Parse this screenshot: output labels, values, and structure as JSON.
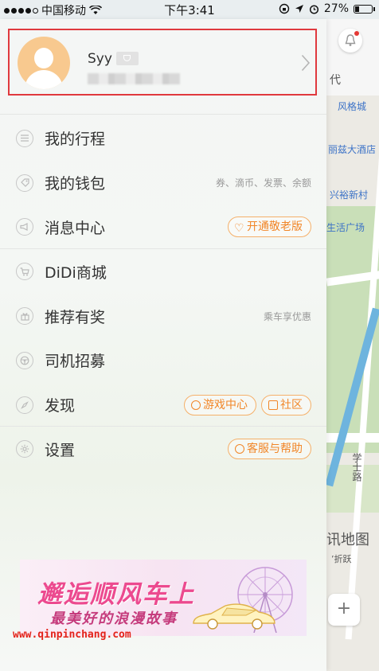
{
  "status_bar": {
    "carrier": "中国移动",
    "time": "下午3:41",
    "battery": "27%",
    "battery_level": 0.27
  },
  "profile": {
    "username": "Syy",
    "phone_masked": ""
  },
  "menu": {
    "items": [
      {
        "label": "我的行程",
        "icon": "list-icon"
      },
      {
        "label": "我的钱包",
        "icon": "wallet-tag-icon",
        "sub": "券、滴币、发票、余额"
      },
      {
        "label": "消息中心",
        "icon": "megaphone-icon",
        "pill": "开通敬老版"
      },
      {
        "label": "DiDi商城",
        "icon": "cart-icon"
      },
      {
        "label": "推荐有奖",
        "icon": "gift-icon",
        "sub": "乘车享优惠"
      },
      {
        "label": "司机招募",
        "icon": "steering-wheel-icon"
      },
      {
        "label": "发现",
        "icon": "compass-icon",
        "pills": [
          "游戏中心",
          "社区"
        ]
      },
      {
        "label": "设置",
        "icon": "gear-icon",
        "pill": "客服与帮助"
      }
    ]
  },
  "map": {
    "labels": [
      "代",
      "风格城",
      "丽兹大酒店",
      "兴裕新村",
      "生活广场",
      "学士路",
      "讯地图",
      "ʼ折跃"
    ]
  },
  "banner": {
    "title": "邂逅顺风车上",
    "subtitle": "最美好的浪漫故事"
  },
  "watermark": "www.qinpinchang.com",
  "colors": {
    "accent": "#f18628",
    "highlight_border": "#e0393e",
    "text": "#333333",
    "muted": "#999999"
  }
}
